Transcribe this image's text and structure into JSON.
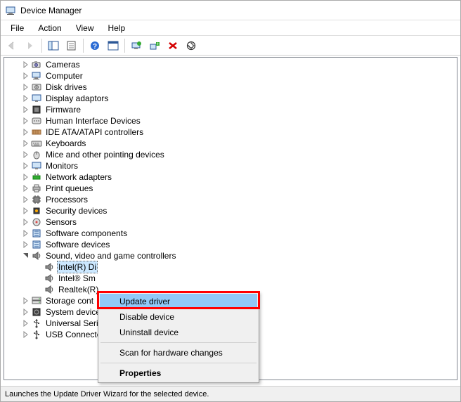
{
  "window": {
    "title": "Device Manager"
  },
  "menubar": {
    "items": [
      "File",
      "Action",
      "View",
      "Help"
    ]
  },
  "toolbar": {
    "icons": [
      "back",
      "forward",
      "show-hide-tree",
      "properties-sheet",
      "help",
      "action-center",
      "display",
      "add-legacy",
      "delete",
      "scan-hardware"
    ]
  },
  "tree": {
    "nodes": [
      {
        "label": "Cameras",
        "icon": "camera",
        "depth": 1,
        "expanded": false
      },
      {
        "label": "Computer",
        "icon": "computer",
        "depth": 1,
        "expanded": false
      },
      {
        "label": "Disk drives",
        "icon": "disk",
        "depth": 1,
        "expanded": false
      },
      {
        "label": "Display adaptors",
        "icon": "display",
        "depth": 1,
        "expanded": false
      },
      {
        "label": "Firmware",
        "icon": "firmware",
        "depth": 1,
        "expanded": false
      },
      {
        "label": "Human Interface Devices",
        "icon": "hid",
        "depth": 1,
        "expanded": false
      },
      {
        "label": "IDE ATA/ATAPI controllers",
        "icon": "ide",
        "depth": 1,
        "expanded": false
      },
      {
        "label": "Keyboards",
        "icon": "keyboard",
        "depth": 1,
        "expanded": false
      },
      {
        "label": "Mice and other pointing devices",
        "icon": "mouse",
        "depth": 1,
        "expanded": false
      },
      {
        "label": "Monitors",
        "icon": "monitor",
        "depth": 1,
        "expanded": false
      },
      {
        "label": "Network adapters",
        "icon": "network",
        "depth": 1,
        "expanded": false
      },
      {
        "label": "Print queues",
        "icon": "printer",
        "depth": 1,
        "expanded": false
      },
      {
        "label": "Processors",
        "icon": "cpu",
        "depth": 1,
        "expanded": false
      },
      {
        "label": "Security devices",
        "icon": "security",
        "depth": 1,
        "expanded": false
      },
      {
        "label": "Sensors",
        "icon": "sensor",
        "depth": 1,
        "expanded": false
      },
      {
        "label": "Software components",
        "icon": "software",
        "depth": 1,
        "expanded": false
      },
      {
        "label": "Software devices",
        "icon": "software",
        "depth": 1,
        "expanded": false
      },
      {
        "label": "Sound, video and game controllers",
        "icon": "sound",
        "depth": 1,
        "expanded": true
      },
      {
        "label": "Intel(R) Display Audio",
        "icon": "sound",
        "depth": 2,
        "expanded": null,
        "selected": true,
        "truncated": "Intel(R) Di"
      },
      {
        "label": "Intel® Sm",
        "icon": "sound",
        "depth": 2,
        "expanded": null
      },
      {
        "label": "Realtek(R)",
        "icon": "sound",
        "depth": 2,
        "expanded": null
      },
      {
        "label": "Storage cont",
        "icon": "storage",
        "depth": 1,
        "expanded": false
      },
      {
        "label": "System device",
        "icon": "system",
        "depth": 1,
        "expanded": false
      },
      {
        "label": "Universal Seri",
        "icon": "usb",
        "depth": 1,
        "expanded": false
      },
      {
        "label": "USB Connecto",
        "icon": "usb",
        "depth": 1,
        "expanded": false
      }
    ]
  },
  "context_menu": {
    "items": [
      {
        "label": "Update driver",
        "highlight": true
      },
      {
        "label": "Disable device"
      },
      {
        "label": "Uninstall device"
      },
      {
        "sep": true
      },
      {
        "label": "Scan for hardware changes"
      },
      {
        "sep": true
      },
      {
        "label": "Properties",
        "bold": true
      }
    ]
  },
  "statusbar": {
    "text": "Launches the Update Driver Wizard for the selected device."
  }
}
